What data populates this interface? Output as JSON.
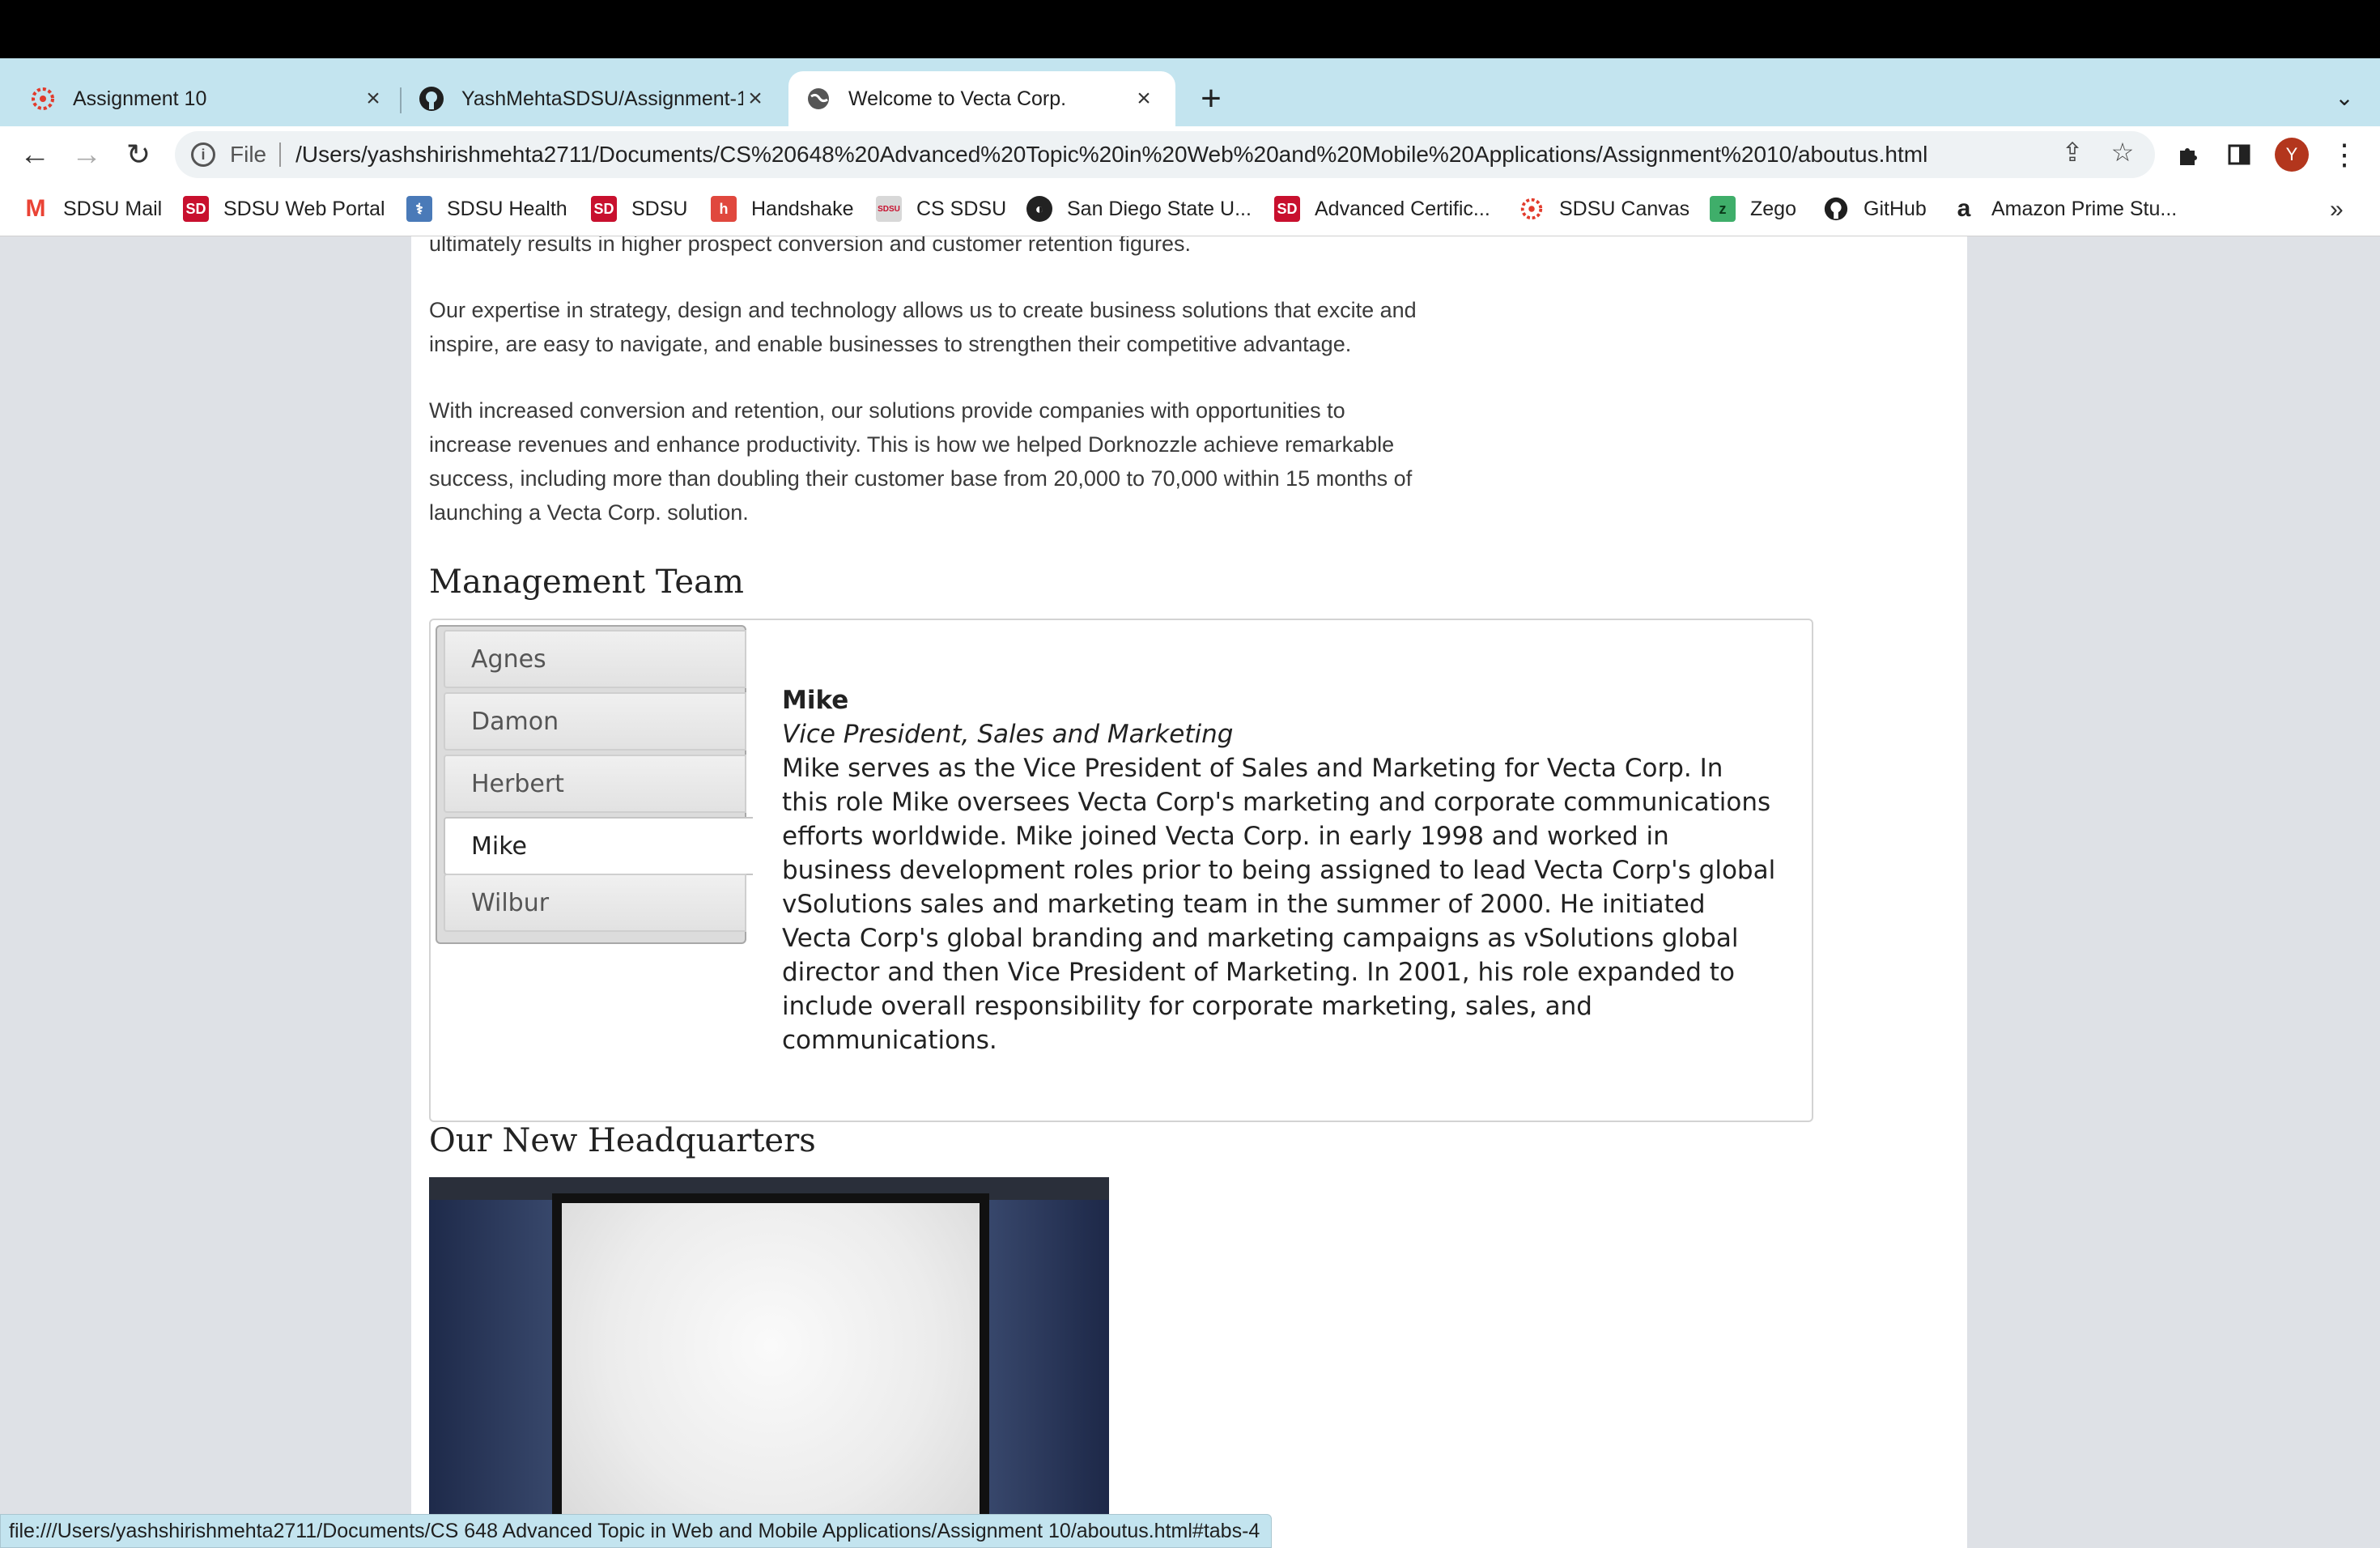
{
  "browser": {
    "tabs": [
      {
        "title": "Assignment 10",
        "favicon": "canvas-icon",
        "active": false
      },
      {
        "title": "YashMehtaSDSU/Assignment-1",
        "favicon": "github-icon",
        "active": false
      },
      {
        "title": "Welcome to Vecta Corp.",
        "favicon": "globe-icon",
        "active": true
      }
    ],
    "omnibox": {
      "scheme_label": "File",
      "url": "/Users/yashshirishmehta2711/Documents/CS%20648%20Advanced%20Topic%20in%20Web%20and%20Mobile%20Applications/Assignment%2010/aboutus.html"
    },
    "avatar_letter": "Y",
    "bookmarks": [
      {
        "label": "SDSU Mail",
        "icon": "gmail-icon",
        "color": "#ea4335"
      },
      {
        "label": "SDSU Web Portal",
        "icon": "sd-icon",
        "color": "#c8102e"
      },
      {
        "label": "SDSU Health",
        "icon": "health-icon",
        "color": "#4a7ab8"
      },
      {
        "label": "SDSU",
        "icon": "sd-icon",
        "color": "#c8102e"
      },
      {
        "label": "Handshake",
        "icon": "handshake-icon",
        "color": "#e0483e"
      },
      {
        "label": "CS SDSU",
        "icon": "cs-sdsu-icon",
        "color": "#c0c0c0"
      },
      {
        "label": "San Diego State U...",
        "icon": "globe-icon",
        "color": "#222222"
      },
      {
        "label": "Advanced Certific...",
        "icon": "sd-icon",
        "color": "#c8102e"
      },
      {
        "label": "SDSU Canvas",
        "icon": "canvas-icon",
        "color": "#e23b2c"
      },
      {
        "label": "Zego",
        "icon": "zego-icon",
        "color": "#3fae6a"
      },
      {
        "label": "GitHub",
        "icon": "github-icon",
        "color": "#222222"
      },
      {
        "label": "Amazon Prime Stu...",
        "icon": "amazon-icon",
        "color": "#222222"
      }
    ],
    "status_url": "file:///Users/yashshirishmehta2711/Documents/CS 648 Advanced Topic in Web and Mobile Applications/Assignment 10/aboutus.html#tabs-4"
  },
  "content": {
    "para_partial": "ultimately results in higher prospect conversion and customer retention figures.",
    "para_expertise_1": "Our expertise in strategy, design and technology allows us to create business solutions that excite and",
    "para_expertise_2": "inspire, are easy to navigate, and enable businesses to strengthen their competitive advantage.",
    "para_conversion_1": "With increased conversion and retention, our solutions provide companies with opportunities to",
    "para_conversion_2": "increase revenues and enhance productivity. This is how we helped Dorknozzle achieve remarkable",
    "para_conversion_3": "success, including more than doubling their customer base from 20,000 to 70,000 within 15 months of",
    "para_conversion_4": "launching a Vecta Corp. solution.",
    "management_heading": "Management Team",
    "team_tabs": [
      "Agnes",
      "Damon",
      "Herbert",
      "Mike",
      "Wilbur"
    ],
    "active_tab": "Mike",
    "panel": {
      "name": "Mike",
      "role": "Vice President, Sales and Marketing",
      "bio": [
        "Mike serves as the Vice President of Sales and Marketing for Vecta Corp. In",
        "this role Mike oversees Vecta Corp's marketing and corporate communications",
        "efforts worldwide. Mike joined Vecta Corp. in early 1998 and worked in",
        "business development roles prior to being assigned to lead Vecta Corp's global",
        "vSolutions sales and marketing team in the summer of 2000. He initiated",
        "Vecta Corp's global branding and marketing campaigns as vSolutions global",
        "director and then Vice President of Marketing. In 2001, his role expanded to",
        "include overall responsibility for corporate marketing, sales, and",
        "communications."
      ]
    },
    "hq_heading": "Our New Headquarters"
  }
}
